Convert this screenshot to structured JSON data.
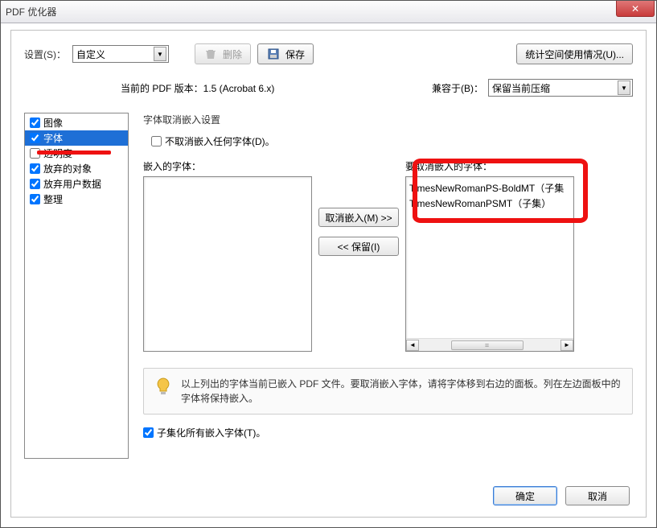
{
  "window": {
    "title": "PDF 优化器"
  },
  "toolbar": {
    "settings_label": "设置(S)：",
    "settings_value": "自定义",
    "delete_label": "删除",
    "save_label": "保存",
    "audit_label": "统计空间使用情况(U)..."
  },
  "meta": {
    "current_version_label": "当前的 PDF 版本：1.5 (Acrobat 6.x)",
    "compat_label": "兼容于(B)：",
    "compat_value": "保留当前压缩"
  },
  "sidebar": {
    "items": [
      {
        "label": "图像",
        "checked": true
      },
      {
        "label": "字体",
        "checked": true,
        "selected": true
      },
      {
        "label": "透明度",
        "checked": false
      },
      {
        "label": "放弃的对象",
        "checked": true
      },
      {
        "label": "放弃用户数据",
        "checked": true
      },
      {
        "label": "整理",
        "checked": true
      }
    ]
  },
  "fonts": {
    "section_title": "字体取消嵌入设置",
    "no_unembed_label": "不取消嵌入任何字体(D)。",
    "no_unembed_checked": false,
    "embedded_label": "嵌入的字体：",
    "unembed_label": "要取消嵌入的字体：",
    "embedded_list": [],
    "unembed_list": [
      "TimesNewRomanPS-BoldMT（子集",
      "TimesNewRomanPSMT（子集）"
    ],
    "btn_unembed": "取消嵌入(M) >>",
    "btn_keep": "<< 保留(I)",
    "info_text": "以上列出的字体当前已嵌入 PDF 文件。要取消嵌入字体，请将字体移到右边的面板。列在左边面板中的字体将保持嵌入。",
    "subset_label": "子集化所有嵌入字体(T)。",
    "subset_checked": true
  },
  "footer": {
    "ok": "确定",
    "cancel": "取消"
  }
}
